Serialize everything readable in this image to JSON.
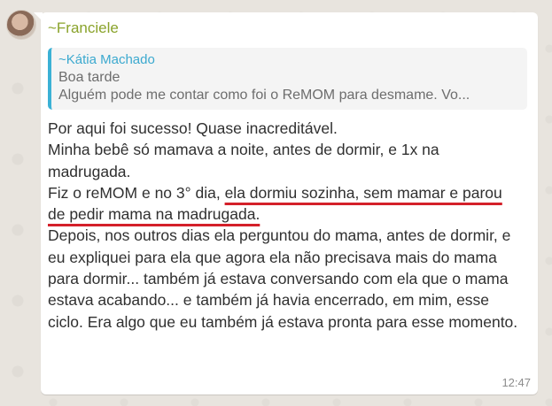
{
  "chat": {
    "sender": "~Franciele",
    "time": "12:47",
    "quote": {
      "author": "~Kátia Machado",
      "line1": "Boa tarde",
      "line2": "Alguém pode me contar como foi o ReMOM para desmame. Vo..."
    },
    "message": {
      "line1": "Por aqui foi sucesso! Quase inacreditável.",
      "line2": "Minha bebê só mamava a noite, antes de dormir, e 1x na madrugada.",
      "line3_plain": "Fiz o reMOM e no 3° dia, ",
      "line3_highlight": "ela dormiu sozinha, sem mamar e parou de pedir mama na madrugada.",
      "line4": "Depois, nos outros dias ela perguntou do mama, antes de dormir, e eu expliquei para ela que agora ela não precisava mais do mama para dormir... também já estava conversando com ela que o mama estava acabando... e também já havia encerrado, em mim, esse ciclo. Era algo que eu também já estava pronta para esse momento."
    },
    "colors": {
      "sender": "#8aa32b",
      "quote_author": "#3ba9cf",
      "quote_bar": "#3bb1d5",
      "underline": "#d4202a"
    }
  }
}
